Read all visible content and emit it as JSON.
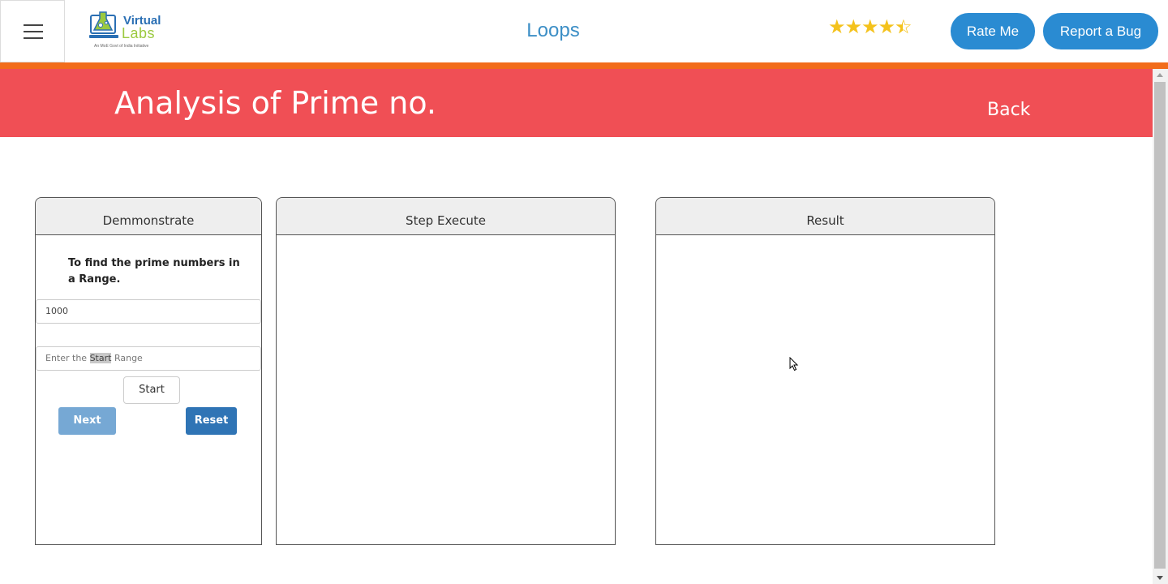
{
  "navbar": {
    "logo_line1": "Virtual",
    "logo_line2": "Labs",
    "logo_tagline": "An MoE Govt of India Initiative",
    "title": "Loops",
    "rating_stars": 4.5,
    "rate_button": "Rate Me",
    "bug_button": "Report a Bug"
  },
  "banner": {
    "title": "Analysis of Prime no.",
    "back_link": "Back"
  },
  "panels": {
    "demonstrate": {
      "heading": "Demmonstrate",
      "instruction": "To find the prime numbers in a Range.",
      "end_range_value": "1000",
      "start_range_placeholder_pre": "Enter the ",
      "start_range_placeholder_highlight": "Start",
      "start_range_placeholder_post": " Range",
      "start_button": "Start",
      "next_button": "Next",
      "reset_button": "Reset"
    },
    "step_execute": {
      "heading": "Step Execute"
    },
    "result": {
      "heading": "Result"
    }
  },
  "colors": {
    "accent_blue": "#2a8bd2",
    "banner_red": "#f04f55",
    "orange_rule": "#f26c1a",
    "star_gold": "#f4c21c"
  }
}
